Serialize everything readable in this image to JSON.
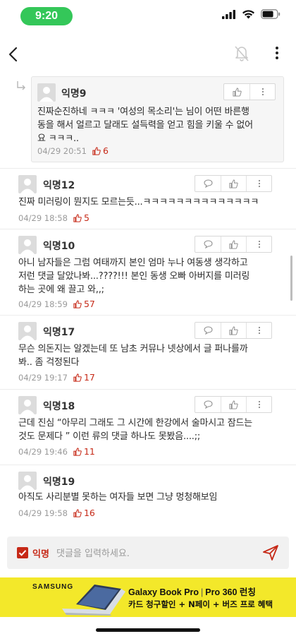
{
  "status_bar": {
    "time": "9:20",
    "time_color": "#34c759"
  },
  "nav": {
    "back_icon": "chevron-left-icon",
    "bell_icon": "bell-off-icon",
    "more_icon": "more-vertical-icon"
  },
  "comments": [
    {
      "author": "익명9",
      "lines": [
        "진짜순진하네 ㅋㅋㅋ '여성의 목소리'는 님이 어떤 바른행",
        "동을 해서 얼르고 달래도 설득력을 얻고 힘을 키울 수 없어",
        "요 ㅋㅋㅋ.."
      ],
      "date": "04/29 20:51",
      "likes": "6",
      "is_reply": true
    },
    {
      "author": "익명12",
      "lines": [
        "진짜 미러링이 뭔지도 모르는듯...ㅋㅋㅋㅋㅋㅋㅋㅋㅋㅋㅋㅋㅋㅋ"
      ],
      "date": "04/29 18:58",
      "likes": "5"
    },
    {
      "author": "익명10",
      "lines": [
        "아니 남자들은 그럼 여태까지 본인 엄마 누나 여동생 생각하고",
        "저런 댓글 달았나봐...????!!! 본인 동생 오빠 아버지를 미러링",
        "하는 곳에 왜 끌고 와,,;"
      ],
      "date": "04/29 18:59",
      "likes": "57"
    },
    {
      "author": "익명17",
      "lines": [
        "무슨 의돈지는 알겠는데 또 남초 커뮤나 넷상에서 글 퍼나를까",
        "봐.. 좀 걱정된다"
      ],
      "date": "04/29 19:17",
      "likes": "17"
    },
    {
      "author": "익명18",
      "lines": [
        "근데 진심 “아무리 그래도 그 시간에 한강에서 술마시고 잠드는",
        "것도 문제다 ” 이런 류의 댓글  하나도 못봤음....;;"
      ],
      "date": "04/29 19:46",
      "likes": "11"
    },
    {
      "author": "익명19",
      "lines": [
        "아직도 사리분별 못하는 여자들 보면 그냥 멍청해보임"
      ],
      "date": "04/29 19:58",
      "likes": "16"
    }
  ],
  "input": {
    "anonymous_label": "익명",
    "placeholder": "댓글을 입력하세요.",
    "send_icon": "send-icon"
  },
  "ad": {
    "brand": "SAMSUNG",
    "product": "Galaxy Book Pro",
    "product_separator": "|",
    "product_variant": "Pro 360 런칭",
    "promo": "카드 청구할인 + N페이 + 버즈 프로 혜택",
    "background": "#f3e82a"
  },
  "colors": {
    "accent_red": "#c62917",
    "meta_gray": "#9a9a9a"
  }
}
